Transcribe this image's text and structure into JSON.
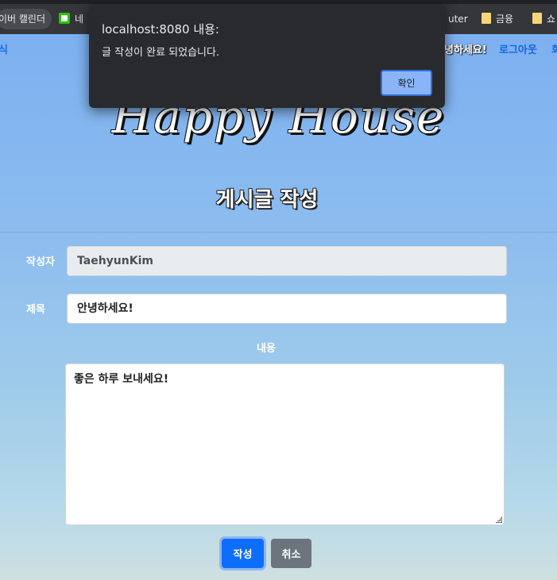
{
  "bookmarks": {
    "item1": "이버 캘린더",
    "item2": "네",
    "item3": "uter",
    "item4": "금융",
    "item5": "쇼"
  },
  "nav": {
    "left_fragment": "식",
    "greeting": "안녕하세요!",
    "logout": "로그아웃",
    "right_fragment": "회"
  },
  "brand": "Happy House",
  "page_heading": "게시글 작성",
  "form": {
    "author_label": "작성자",
    "author_value": "TaehyunKim",
    "title_label": "제목",
    "title_value": "안녕하세요!",
    "content_label": "내용",
    "content_value": "좋은 하루 보내세요!",
    "submit_label": "작성",
    "cancel_label": "취소"
  },
  "dialog": {
    "title": "localhost:8080 내용:",
    "message": "글 작성이 완료 되었습니다.",
    "ok_label": "확인"
  }
}
